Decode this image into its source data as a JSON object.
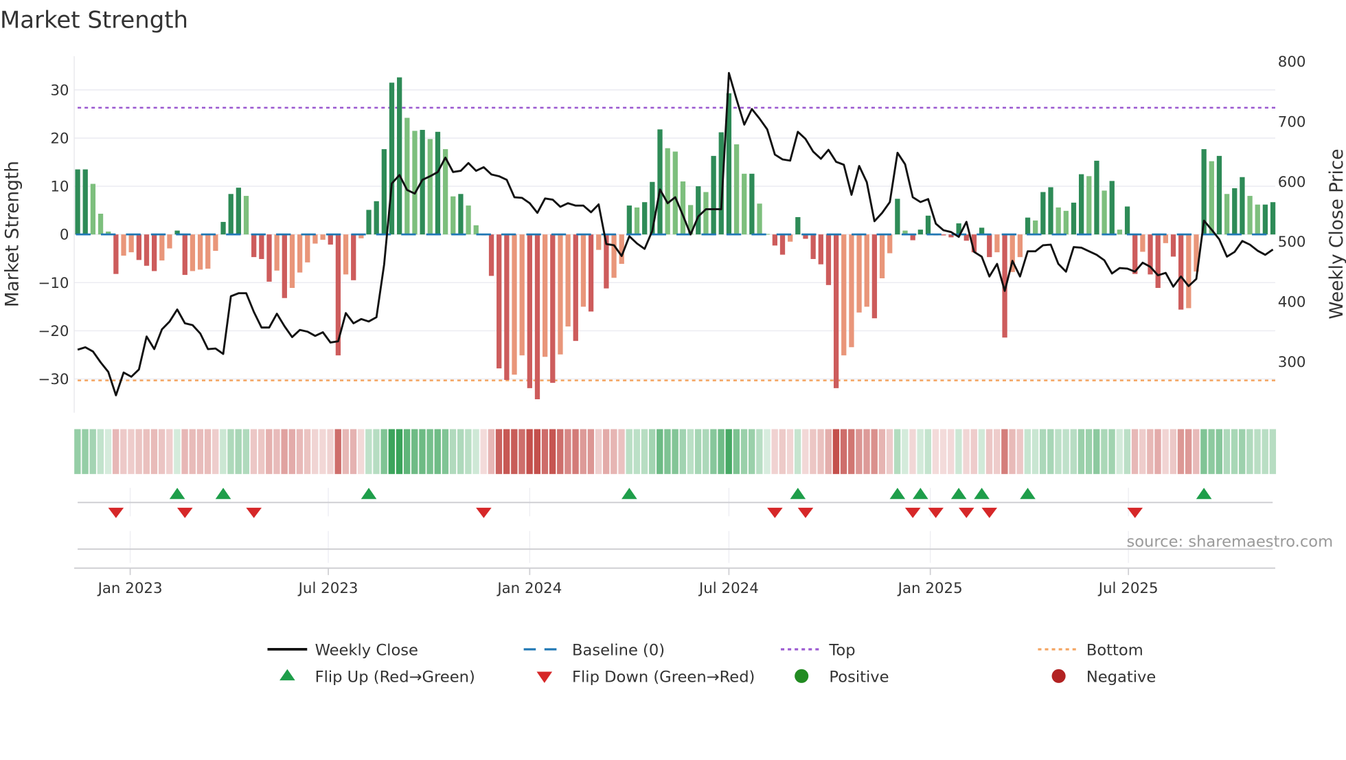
{
  "title": "Market Strength",
  "source": "source: sharemaestro.com",
  "colors": {
    "strong_green": "#2e8b57",
    "weak_green": "#7dbf7d",
    "strong_red": "#cd5c5c",
    "weak_red": "#e9967a",
    "baseline": "#1f77b4",
    "top": "#9b59d0",
    "bottom": "#f4a460",
    "close": "#111111",
    "flip_up": "#1e9e4a",
    "flip_down": "#d62728",
    "positive": "#228b22",
    "negative": "#b22222",
    "heat_green": "#3aa35a",
    "heat_red": "#c4504c"
  },
  "legend": {
    "weekly_close": "Weekly Close",
    "baseline": "Baseline (0)",
    "top": "Top",
    "bottom": "Bottom",
    "flip_up": "Flip Up (Red→Green)",
    "flip_down": "Flip Down (Green→Red)",
    "positive": "Positive",
    "negative": "Negative"
  },
  "chart_data": {
    "type": "bar",
    "title": "Market Strength",
    "ylabel": "Market Strength",
    "y2label": "Weekly Close Price",
    "frequency": "weekly",
    "start_date": "2022-11-14",
    "ylim": [
      -37,
      37
    ],
    "y2lim": [
      215,
      809
    ],
    "yticks": [
      -30,
      -20,
      -10,
      0,
      10,
      20,
      30
    ],
    "y2ticks": [
      300,
      400,
      500,
      600,
      700,
      800
    ],
    "xticks": [
      {
        "date": "2023-01-01",
        "label": "Jan 2023"
      },
      {
        "date": "2023-07-01",
        "label": "Jul 2023"
      },
      {
        "date": "2024-01-01",
        "label": "Jan 2024"
      },
      {
        "date": "2024-07-01",
        "label": "Jul 2024"
      },
      {
        "date": "2025-01-01",
        "label": "Jan 2025"
      },
      {
        "date": "2025-07-01",
        "label": "Jul 2025"
      }
    ],
    "top_level": 26.3,
    "bottom_level": -30.3,
    "baseline": 0,
    "strength": [
      13.5,
      13.5,
      10.5,
      4.3,
      0.6,
      -8.2,
      -4.4,
      -3.7,
      -5.3,
      -6.5,
      -7.6,
      -5.4,
      -2.9,
      0.8,
      -8.4,
      -7.6,
      -7.3,
      -7.1,
      -3.4,
      2.6,
      8.4,
      9.7,
      8.0,
      -4.7,
      -5.1,
      -9.8,
      -7.5,
      -13.2,
      -11.1,
      -7.9,
      -5.8,
      -1.9,
      -1.1,
      -2.1,
      -25.1,
      -8.3,
      -9.5,
      -0.8,
      5.1,
      6.9,
      17.7,
      31.5,
      32.6,
      24.2,
      21.5,
      21.7,
      19.8,
      21.3,
      17.7,
      7.9,
      8.4,
      6.0,
      1.9,
      -0.2,
      -8.6,
      -27.8,
      -30.2,
      -29.1,
      -25.1,
      -31.9,
      -34.2,
      -25.4,
      -30.8,
      -24.9,
      -19.1,
      -22.1,
      -15.0,
      -16.0,
      -3.2,
      -11.2,
      -9.0,
      -6.1,
      6.0,
      5.6,
      6.7,
      10.9,
      21.8,
      17.9,
      17.2,
      11.0,
      6.1,
      10.0,
      8.8,
      16.3,
      21.2,
      29.3,
      18.7,
      12.6,
      12.6,
      6.4,
      0.1,
      -2.3,
      -4.2,
      -1.5,
      3.6,
      -0.9,
      -5.1,
      -6.2,
      -10.5,
      -31.9,
      -25.1,
      -23.4,
      -16.2,
      -15.0,
      -17.4,
      -9.1,
      -3.9,
      7.4,
      0.8,
      -1.2,
      1.0,
      3.9,
      -0.2,
      -0.2,
      -0.6,
      2.3,
      -1.3,
      -3.7,
      1.4,
      -4.7,
      -3.7,
      -21.4,
      -7.8,
      -4.7,
      3.5,
      2.9,
      8.8,
      9.8,
      5.6,
      4.9,
      6.6,
      12.5,
      12.1,
      15.3,
      9.1,
      11.1,
      1.0,
      5.8,
      -8.2,
      -3.6,
      -8.3,
      -11.1,
      -1.8,
      -4.6,
      -15.6,
      -15.3,
      -7.7,
      17.7,
      15.2,
      16.3,
      8.4,
      9.6,
      11.9,
      8.0,
      6.2,
      6.2,
      6.7
    ],
    "close": [
      320,
      324,
      317,
      299,
      283,
      244,
      282,
      275,
      287,
      342,
      321,
      354,
      367,
      387,
      364,
      361,
      347,
      321,
      322,
      313,
      409,
      414,
      414,
      383,
      357,
      357,
      380,
      359,
      341,
      353,
      350,
      343,
      349,
      332,
      334,
      381,
      364,
      371,
      367,
      374,
      462,
      597,
      611,
      586,
      580,
      603,
      609,
      616,
      640,
      616,
      618,
      631,
      618,
      624,
      612,
      609,
      603,
      574,
      573,
      564,
      548,
      572,
      570,
      558,
      564,
      560,
      560,
      549,
      562,
      496,
      494,
      476,
      509,
      497,
      488,
      518,
      587,
      564,
      574,
      544,
      512,
      542,
      554,
      554,
      554,
      781,
      737,
      695,
      721,
      705,
      687,
      645,
      637,
      635,
      683,
      671,
      650,
      638,
      653,
      633,
      628,
      578,
      626,
      599,
      534,
      548,
      566,
      648,
      629,
      574,
      566,
      571,
      530,
      519,
      516,
      508,
      533,
      483,
      475,
      442,
      463,
      418,
      468,
      442,
      484,
      484,
      494,
      495,
      463,
      450,
      491,
      490,
      484,
      478,
      469,
      447,
      456,
      455,
      450,
      465,
      458,
      444,
      448,
      425,
      442,
      426,
      438,
      535,
      520,
      504,
      475,
      483,
      501,
      495,
      485,
      478,
      487
    ],
    "flip_up_weeks": [
      14,
      20,
      39,
      73,
      95,
      108,
      111,
      116,
      119,
      125,
      148
    ],
    "flip_down_weeks": [
      6,
      15,
      24,
      54,
      92,
      96,
      110,
      113,
      117,
      120,
      139
    ],
    "legend_position": "bottom"
  }
}
